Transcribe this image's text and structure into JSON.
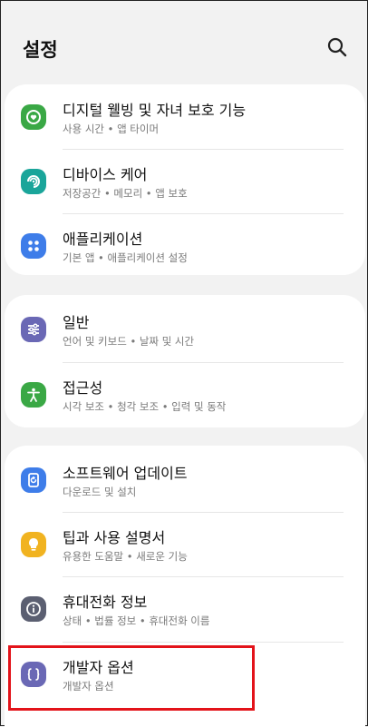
{
  "header": {
    "title": "설정",
    "search_icon": "search-icon"
  },
  "groups": [
    {
      "items": [
        {
          "title": "디지털 웰빙 및 자녀 보호 기능",
          "subtitle": "사용 시간 • 앱 타이머",
          "icon": "digital-wellbeing-icon",
          "color": "#3aa845"
        },
        {
          "title": "디바이스 케어",
          "subtitle": "저장공간 • 메모리 • 앱 보호",
          "icon": "device-care-icon",
          "color": "#1aa59a"
        },
        {
          "title": "애플리케이션",
          "subtitle": "기본 앱 • 애플리케이션 설정",
          "icon": "apps-icon",
          "color": "#3e7de9"
        }
      ]
    },
    {
      "items": [
        {
          "title": "일반",
          "subtitle": "언어 및 키보드 • 날짜 및 시간",
          "icon": "sliders-icon",
          "color": "#6a68b5"
        },
        {
          "title": "접근성",
          "subtitle": "시각 보조 • 청각 보조 • 입력 및 동작",
          "icon": "accessibility-icon",
          "color": "#3aa845"
        }
      ]
    },
    {
      "items": [
        {
          "title": "소프트웨어 업데이트",
          "subtitle": "다운로드 및 설치",
          "icon": "software-update-icon",
          "color": "#3e7de9"
        },
        {
          "title": "팁과 사용 설명서",
          "subtitle": "유용한 도움말 • 새로운 기능",
          "icon": "lightbulb-icon",
          "color": "#f1b320"
        },
        {
          "title": "휴대전화 정보",
          "subtitle": "상태 • 법률 정보 • 휴대전화 이름",
          "icon": "info-icon",
          "color": "#5b5f71"
        },
        {
          "title": "개발자 옵션",
          "subtitle": "개발자 옵션",
          "icon": "developer-options-icon",
          "color": "#6a68b5"
        }
      ]
    }
  ],
  "highlight_color": "#e3131a"
}
